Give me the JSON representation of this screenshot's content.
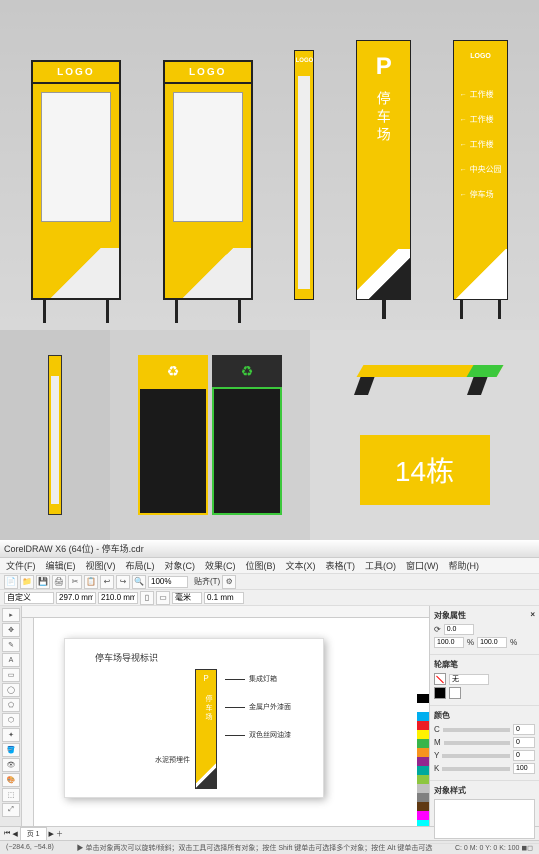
{
  "preview": {
    "signboard_logo": "LOGO",
    "pylon_logo": "LOGO",
    "parking_p": "P",
    "parking_text": "停车场",
    "dir_logo": "LOGO",
    "dir_items": [
      "工作楼",
      "工作楼",
      "工作楼",
      "中央公园",
      "停车场"
    ],
    "plaque_text": "14栋",
    "recycle_icon": "♻"
  },
  "app": {
    "title": "CorelDRAW X6 (64位) - 停车场.cdr",
    "menu": [
      "文件(F)",
      "编辑(E)",
      "视图(V)",
      "布局(L)",
      "对象(C)",
      "效果(C)",
      "位图(B)",
      "文本(X)",
      "表格(T)",
      "工具(O)",
      "窗口(W)",
      "帮助(H)"
    ],
    "toolbar1_icons": [
      "📄",
      "📁",
      "💾",
      "🖨",
      "✂",
      "📋",
      "↩",
      "↪",
      "🔍",
      "⚙"
    ],
    "zoom_value": "100%",
    "snap_label": "贴齐(T)",
    "propbar": {
      "paper_label": "自定义",
      "width": "297.0 mm",
      "height": "210.0 mm",
      "units": "毫米",
      "nudge": "0.1 mm"
    },
    "toolbox": [
      "▸",
      "✥",
      "✎",
      "A",
      "▭",
      "◯",
      "⬠",
      "⬡",
      "✦",
      "🪣",
      "👁",
      "🎨",
      "⬚",
      "⤢"
    ],
    "artboard": {
      "title": "停车场导视标识",
      "sign_p": "P",
      "sign_text": "停车场",
      "callouts": [
        "集成灯箱",
        "金属户外漆面",
        "双色丝网油漆"
      ],
      "baseline": "水泥预埋件"
    },
    "panels": {
      "transform_head": "对象属性",
      "rotation": "0.0",
      "scale_x": "100.0",
      "scale_y": "100.0",
      "outline_head": "轮廓笔",
      "outline_width": "无",
      "color_head": "颜色",
      "c": "0",
      "m": "0",
      "y": "0",
      "k": "100",
      "props_head": "对象样式"
    },
    "palette_colors": [
      "#000",
      "#fff",
      "#00aeef",
      "#ed1c24",
      "#fff200",
      "#39b54a",
      "#f7941d",
      "#92278f",
      "#00a99d",
      "#8dc63f",
      "#c0c0c0",
      "#808080",
      "#603913",
      "#ff00ff",
      "#00ffff",
      "#ffff00"
    ],
    "page_tabs": [
      "页 1"
    ],
    "status": {
      "left": "(−284.6, −54.8)",
      "center": "▶ 单击对象两次可以旋转/倾斜；双击工具可选择所有对象；按住 Shift 键单击可选择多个对象；按住 Alt 键单击可选",
      "right": "C: 0 M: 0 Y: 0 K: 100  ◼◻"
    }
  }
}
